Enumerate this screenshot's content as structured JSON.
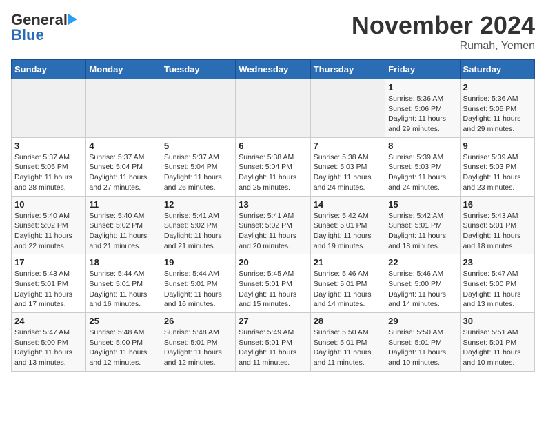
{
  "header": {
    "logo_general": "General",
    "logo_blue": "Blue",
    "title": "November 2024",
    "location": "Rumah, Yemen"
  },
  "weekdays": [
    "Sunday",
    "Monday",
    "Tuesday",
    "Wednesday",
    "Thursday",
    "Friday",
    "Saturday"
  ],
  "weeks": [
    [
      {
        "day": "",
        "info": ""
      },
      {
        "day": "",
        "info": ""
      },
      {
        "day": "",
        "info": ""
      },
      {
        "day": "",
        "info": ""
      },
      {
        "day": "",
        "info": ""
      },
      {
        "day": "1",
        "info": "Sunrise: 5:36 AM\nSunset: 5:06 PM\nDaylight: 11 hours and 29 minutes."
      },
      {
        "day": "2",
        "info": "Sunrise: 5:36 AM\nSunset: 5:05 PM\nDaylight: 11 hours and 29 minutes."
      }
    ],
    [
      {
        "day": "3",
        "info": "Sunrise: 5:37 AM\nSunset: 5:05 PM\nDaylight: 11 hours and 28 minutes."
      },
      {
        "day": "4",
        "info": "Sunrise: 5:37 AM\nSunset: 5:04 PM\nDaylight: 11 hours and 27 minutes."
      },
      {
        "day": "5",
        "info": "Sunrise: 5:37 AM\nSunset: 5:04 PM\nDaylight: 11 hours and 26 minutes."
      },
      {
        "day": "6",
        "info": "Sunrise: 5:38 AM\nSunset: 5:04 PM\nDaylight: 11 hours and 25 minutes."
      },
      {
        "day": "7",
        "info": "Sunrise: 5:38 AM\nSunset: 5:03 PM\nDaylight: 11 hours and 24 minutes."
      },
      {
        "day": "8",
        "info": "Sunrise: 5:39 AM\nSunset: 5:03 PM\nDaylight: 11 hours and 24 minutes."
      },
      {
        "day": "9",
        "info": "Sunrise: 5:39 AM\nSunset: 5:03 PM\nDaylight: 11 hours and 23 minutes."
      }
    ],
    [
      {
        "day": "10",
        "info": "Sunrise: 5:40 AM\nSunset: 5:02 PM\nDaylight: 11 hours and 22 minutes."
      },
      {
        "day": "11",
        "info": "Sunrise: 5:40 AM\nSunset: 5:02 PM\nDaylight: 11 hours and 21 minutes."
      },
      {
        "day": "12",
        "info": "Sunrise: 5:41 AM\nSunset: 5:02 PM\nDaylight: 11 hours and 21 minutes."
      },
      {
        "day": "13",
        "info": "Sunrise: 5:41 AM\nSunset: 5:02 PM\nDaylight: 11 hours and 20 minutes."
      },
      {
        "day": "14",
        "info": "Sunrise: 5:42 AM\nSunset: 5:01 PM\nDaylight: 11 hours and 19 minutes."
      },
      {
        "day": "15",
        "info": "Sunrise: 5:42 AM\nSunset: 5:01 PM\nDaylight: 11 hours and 18 minutes."
      },
      {
        "day": "16",
        "info": "Sunrise: 5:43 AM\nSunset: 5:01 PM\nDaylight: 11 hours and 18 minutes."
      }
    ],
    [
      {
        "day": "17",
        "info": "Sunrise: 5:43 AM\nSunset: 5:01 PM\nDaylight: 11 hours and 17 minutes."
      },
      {
        "day": "18",
        "info": "Sunrise: 5:44 AM\nSunset: 5:01 PM\nDaylight: 11 hours and 16 minutes."
      },
      {
        "day": "19",
        "info": "Sunrise: 5:44 AM\nSunset: 5:01 PM\nDaylight: 11 hours and 16 minutes."
      },
      {
        "day": "20",
        "info": "Sunrise: 5:45 AM\nSunset: 5:01 PM\nDaylight: 11 hours and 15 minutes."
      },
      {
        "day": "21",
        "info": "Sunrise: 5:46 AM\nSunset: 5:01 PM\nDaylight: 11 hours and 14 minutes."
      },
      {
        "day": "22",
        "info": "Sunrise: 5:46 AM\nSunset: 5:00 PM\nDaylight: 11 hours and 14 minutes."
      },
      {
        "day": "23",
        "info": "Sunrise: 5:47 AM\nSunset: 5:00 PM\nDaylight: 11 hours and 13 minutes."
      }
    ],
    [
      {
        "day": "24",
        "info": "Sunrise: 5:47 AM\nSunset: 5:00 PM\nDaylight: 11 hours and 13 minutes."
      },
      {
        "day": "25",
        "info": "Sunrise: 5:48 AM\nSunset: 5:00 PM\nDaylight: 11 hours and 12 minutes."
      },
      {
        "day": "26",
        "info": "Sunrise: 5:48 AM\nSunset: 5:01 PM\nDaylight: 11 hours and 12 minutes."
      },
      {
        "day": "27",
        "info": "Sunrise: 5:49 AM\nSunset: 5:01 PM\nDaylight: 11 hours and 11 minutes."
      },
      {
        "day": "28",
        "info": "Sunrise: 5:50 AM\nSunset: 5:01 PM\nDaylight: 11 hours and 11 minutes."
      },
      {
        "day": "29",
        "info": "Sunrise: 5:50 AM\nSunset: 5:01 PM\nDaylight: 11 hours and 10 minutes."
      },
      {
        "day": "30",
        "info": "Sunrise: 5:51 AM\nSunset: 5:01 PM\nDaylight: 11 hours and 10 minutes."
      }
    ]
  ]
}
